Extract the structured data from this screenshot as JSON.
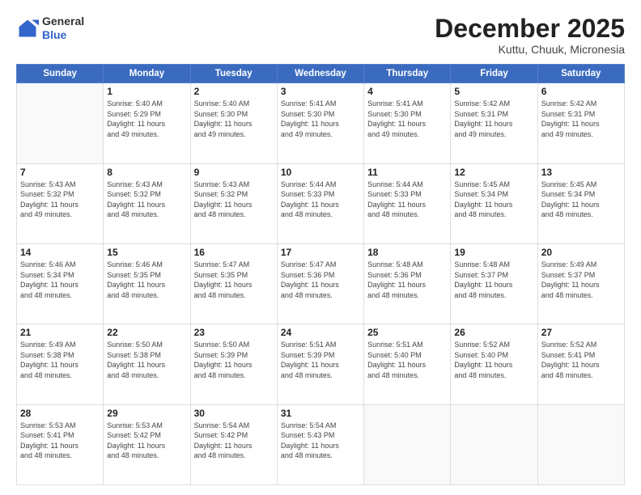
{
  "header": {
    "logo_general": "General",
    "logo_blue": "Blue",
    "month_title": "December 2025",
    "location": "Kuttu, Chuuk, Micronesia"
  },
  "days_of_week": [
    "Sunday",
    "Monday",
    "Tuesday",
    "Wednesday",
    "Thursday",
    "Friday",
    "Saturday"
  ],
  "weeks": [
    [
      {
        "day": "",
        "info": ""
      },
      {
        "day": "1",
        "info": "Sunrise: 5:40 AM\nSunset: 5:29 PM\nDaylight: 11 hours\nand 49 minutes."
      },
      {
        "day": "2",
        "info": "Sunrise: 5:40 AM\nSunset: 5:30 PM\nDaylight: 11 hours\nand 49 minutes."
      },
      {
        "day": "3",
        "info": "Sunrise: 5:41 AM\nSunset: 5:30 PM\nDaylight: 11 hours\nand 49 minutes."
      },
      {
        "day": "4",
        "info": "Sunrise: 5:41 AM\nSunset: 5:30 PM\nDaylight: 11 hours\nand 49 minutes."
      },
      {
        "day": "5",
        "info": "Sunrise: 5:42 AM\nSunset: 5:31 PM\nDaylight: 11 hours\nand 49 minutes."
      },
      {
        "day": "6",
        "info": "Sunrise: 5:42 AM\nSunset: 5:31 PM\nDaylight: 11 hours\nand 49 minutes."
      }
    ],
    [
      {
        "day": "7",
        "info": "Sunrise: 5:43 AM\nSunset: 5:32 PM\nDaylight: 11 hours\nand 49 minutes."
      },
      {
        "day": "8",
        "info": "Sunrise: 5:43 AM\nSunset: 5:32 PM\nDaylight: 11 hours\nand 48 minutes."
      },
      {
        "day": "9",
        "info": "Sunrise: 5:43 AM\nSunset: 5:32 PM\nDaylight: 11 hours\nand 48 minutes."
      },
      {
        "day": "10",
        "info": "Sunrise: 5:44 AM\nSunset: 5:33 PM\nDaylight: 11 hours\nand 48 minutes."
      },
      {
        "day": "11",
        "info": "Sunrise: 5:44 AM\nSunset: 5:33 PM\nDaylight: 11 hours\nand 48 minutes."
      },
      {
        "day": "12",
        "info": "Sunrise: 5:45 AM\nSunset: 5:34 PM\nDaylight: 11 hours\nand 48 minutes."
      },
      {
        "day": "13",
        "info": "Sunrise: 5:45 AM\nSunset: 5:34 PM\nDaylight: 11 hours\nand 48 minutes."
      }
    ],
    [
      {
        "day": "14",
        "info": "Sunrise: 5:46 AM\nSunset: 5:34 PM\nDaylight: 11 hours\nand 48 minutes."
      },
      {
        "day": "15",
        "info": "Sunrise: 5:46 AM\nSunset: 5:35 PM\nDaylight: 11 hours\nand 48 minutes."
      },
      {
        "day": "16",
        "info": "Sunrise: 5:47 AM\nSunset: 5:35 PM\nDaylight: 11 hours\nand 48 minutes."
      },
      {
        "day": "17",
        "info": "Sunrise: 5:47 AM\nSunset: 5:36 PM\nDaylight: 11 hours\nand 48 minutes."
      },
      {
        "day": "18",
        "info": "Sunrise: 5:48 AM\nSunset: 5:36 PM\nDaylight: 11 hours\nand 48 minutes."
      },
      {
        "day": "19",
        "info": "Sunrise: 5:48 AM\nSunset: 5:37 PM\nDaylight: 11 hours\nand 48 minutes."
      },
      {
        "day": "20",
        "info": "Sunrise: 5:49 AM\nSunset: 5:37 PM\nDaylight: 11 hours\nand 48 minutes."
      }
    ],
    [
      {
        "day": "21",
        "info": "Sunrise: 5:49 AM\nSunset: 5:38 PM\nDaylight: 11 hours\nand 48 minutes."
      },
      {
        "day": "22",
        "info": "Sunrise: 5:50 AM\nSunset: 5:38 PM\nDaylight: 11 hours\nand 48 minutes."
      },
      {
        "day": "23",
        "info": "Sunrise: 5:50 AM\nSunset: 5:39 PM\nDaylight: 11 hours\nand 48 minutes."
      },
      {
        "day": "24",
        "info": "Sunrise: 5:51 AM\nSunset: 5:39 PM\nDaylight: 11 hours\nand 48 minutes."
      },
      {
        "day": "25",
        "info": "Sunrise: 5:51 AM\nSunset: 5:40 PM\nDaylight: 11 hours\nand 48 minutes."
      },
      {
        "day": "26",
        "info": "Sunrise: 5:52 AM\nSunset: 5:40 PM\nDaylight: 11 hours\nand 48 minutes."
      },
      {
        "day": "27",
        "info": "Sunrise: 5:52 AM\nSunset: 5:41 PM\nDaylight: 11 hours\nand 48 minutes."
      }
    ],
    [
      {
        "day": "28",
        "info": "Sunrise: 5:53 AM\nSunset: 5:41 PM\nDaylight: 11 hours\nand 48 minutes."
      },
      {
        "day": "29",
        "info": "Sunrise: 5:53 AM\nSunset: 5:42 PM\nDaylight: 11 hours\nand 48 minutes."
      },
      {
        "day": "30",
        "info": "Sunrise: 5:54 AM\nSunset: 5:42 PM\nDaylight: 11 hours\nand 48 minutes."
      },
      {
        "day": "31",
        "info": "Sunrise: 5:54 AM\nSunset: 5:43 PM\nDaylight: 11 hours\nand 48 minutes."
      },
      {
        "day": "",
        "info": ""
      },
      {
        "day": "",
        "info": ""
      },
      {
        "day": "",
        "info": ""
      }
    ]
  ]
}
